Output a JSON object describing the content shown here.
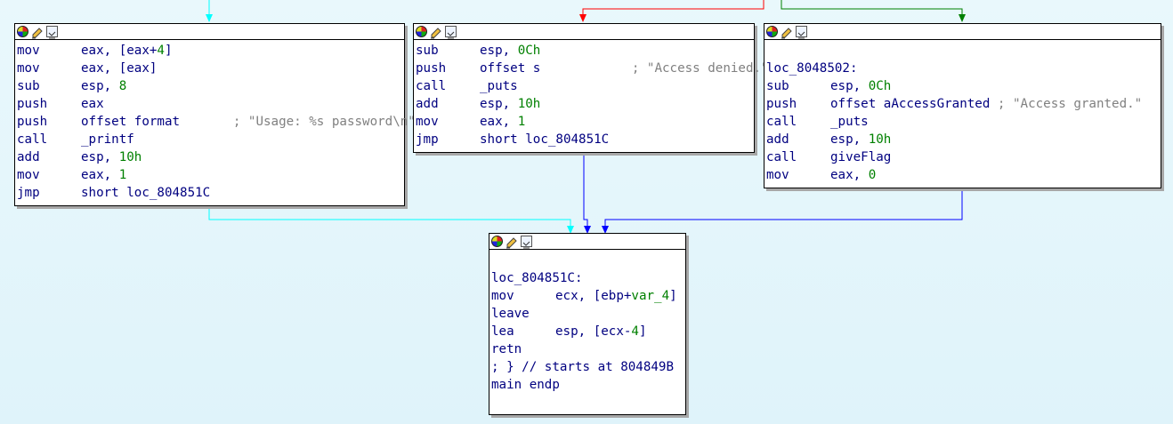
{
  "blocks": {
    "usage": {
      "lines": [
        {
          "mnem": "mov",
          "ops": [
            {
              "t": "eax, [eax+"
            },
            {
              "t": "4",
              "n": true
            },
            {
              "t": "]"
            }
          ]
        },
        {
          "mnem": "mov",
          "ops": [
            {
              "t": "eax, [eax]"
            }
          ]
        },
        {
          "mnem": "sub",
          "ops": [
            {
              "t": "esp, "
            },
            {
              "t": "8",
              "n": true
            }
          ]
        },
        {
          "mnem": "push",
          "ops": [
            {
              "t": "eax"
            }
          ]
        },
        {
          "mnem": "push",
          "ops": [
            {
              "t": "offset format"
            }
          ],
          "comment": "; \"Usage: %s password\\n\""
        },
        {
          "mnem": "call",
          "ops": [
            {
              "t": "_printf"
            }
          ]
        },
        {
          "mnem": "add",
          "ops": [
            {
              "t": "esp, "
            },
            {
              "t": "10h",
              "n": true
            }
          ]
        },
        {
          "mnem": "mov",
          "ops": [
            {
              "t": "eax, "
            },
            {
              "t": "1",
              "n": true
            }
          ]
        },
        {
          "mnem": "jmp",
          "ops": [
            {
              "t": "short loc_804851C"
            }
          ]
        }
      ]
    },
    "denied": {
      "lines": [
        {
          "mnem": "sub",
          "ops": [
            {
              "t": "esp, "
            },
            {
              "t": "0Ch",
              "n": true
            }
          ]
        },
        {
          "mnem": "push",
          "ops": [
            {
              "t": "offset s"
            }
          ],
          "comment": "; \"Access denied.\""
        },
        {
          "mnem": "call",
          "ops": [
            {
              "t": "_puts"
            }
          ]
        },
        {
          "mnem": "add",
          "ops": [
            {
              "t": "esp, "
            },
            {
              "t": "10h",
              "n": true
            }
          ]
        },
        {
          "mnem": "mov",
          "ops": [
            {
              "t": "eax, "
            },
            {
              "t": "1",
              "n": true
            }
          ]
        },
        {
          "mnem": "jmp",
          "ops": [
            {
              "t": "short loc_804851C"
            }
          ]
        }
      ]
    },
    "granted": {
      "lines": [
        {
          "blank": true
        },
        {
          "label": "loc_8048502:"
        },
        {
          "mnem": "sub",
          "ops": [
            {
              "t": "esp, "
            },
            {
              "t": "0Ch",
              "n": true
            }
          ]
        },
        {
          "mnem": "push",
          "ops": [
            {
              "t": "offset aAccessGranted"
            }
          ],
          "comment": "; \"Access granted.\""
        },
        {
          "mnem": "call",
          "ops": [
            {
              "t": "_puts"
            }
          ]
        },
        {
          "mnem": "add",
          "ops": [
            {
              "t": "esp, "
            },
            {
              "t": "10h",
              "n": true
            }
          ]
        },
        {
          "mnem": "call",
          "ops": [
            {
              "t": "giveFlag"
            }
          ]
        },
        {
          "mnem": "mov",
          "ops": [
            {
              "t": "eax, "
            },
            {
              "t": "0",
              "n": true
            }
          ]
        }
      ]
    },
    "exit": {
      "lines": [
        {
          "blank": true
        },
        {
          "label": "loc_804851C:"
        },
        {
          "mnem": "mov",
          "ops": [
            {
              "t": "ecx, [ebp+"
            },
            {
              "t": "var_4",
              "n": true
            },
            {
              "t": "]"
            }
          ]
        },
        {
          "label": "leave"
        },
        {
          "mnem": "lea",
          "ops": [
            {
              "t": "esp, [ecx-"
            },
            {
              "t": "4",
              "n": true
            },
            {
              "t": "]"
            }
          ]
        },
        {
          "label": "retn"
        },
        {
          "label": "; } // starts at 804849B"
        },
        {
          "label": "main endp"
        }
      ]
    }
  },
  "colors": {
    "background": "#e2f5fb",
    "edge_unconditional": "#0000ff",
    "edge_true": "#008000",
    "edge_false": "#ff0000",
    "edge_selected": "#00ffff",
    "instruction_text": "#000080",
    "number_text": "#008000",
    "comment_text": "#808080"
  },
  "icons": [
    "color-icon",
    "rename-icon",
    "graph-overview-icon"
  ]
}
